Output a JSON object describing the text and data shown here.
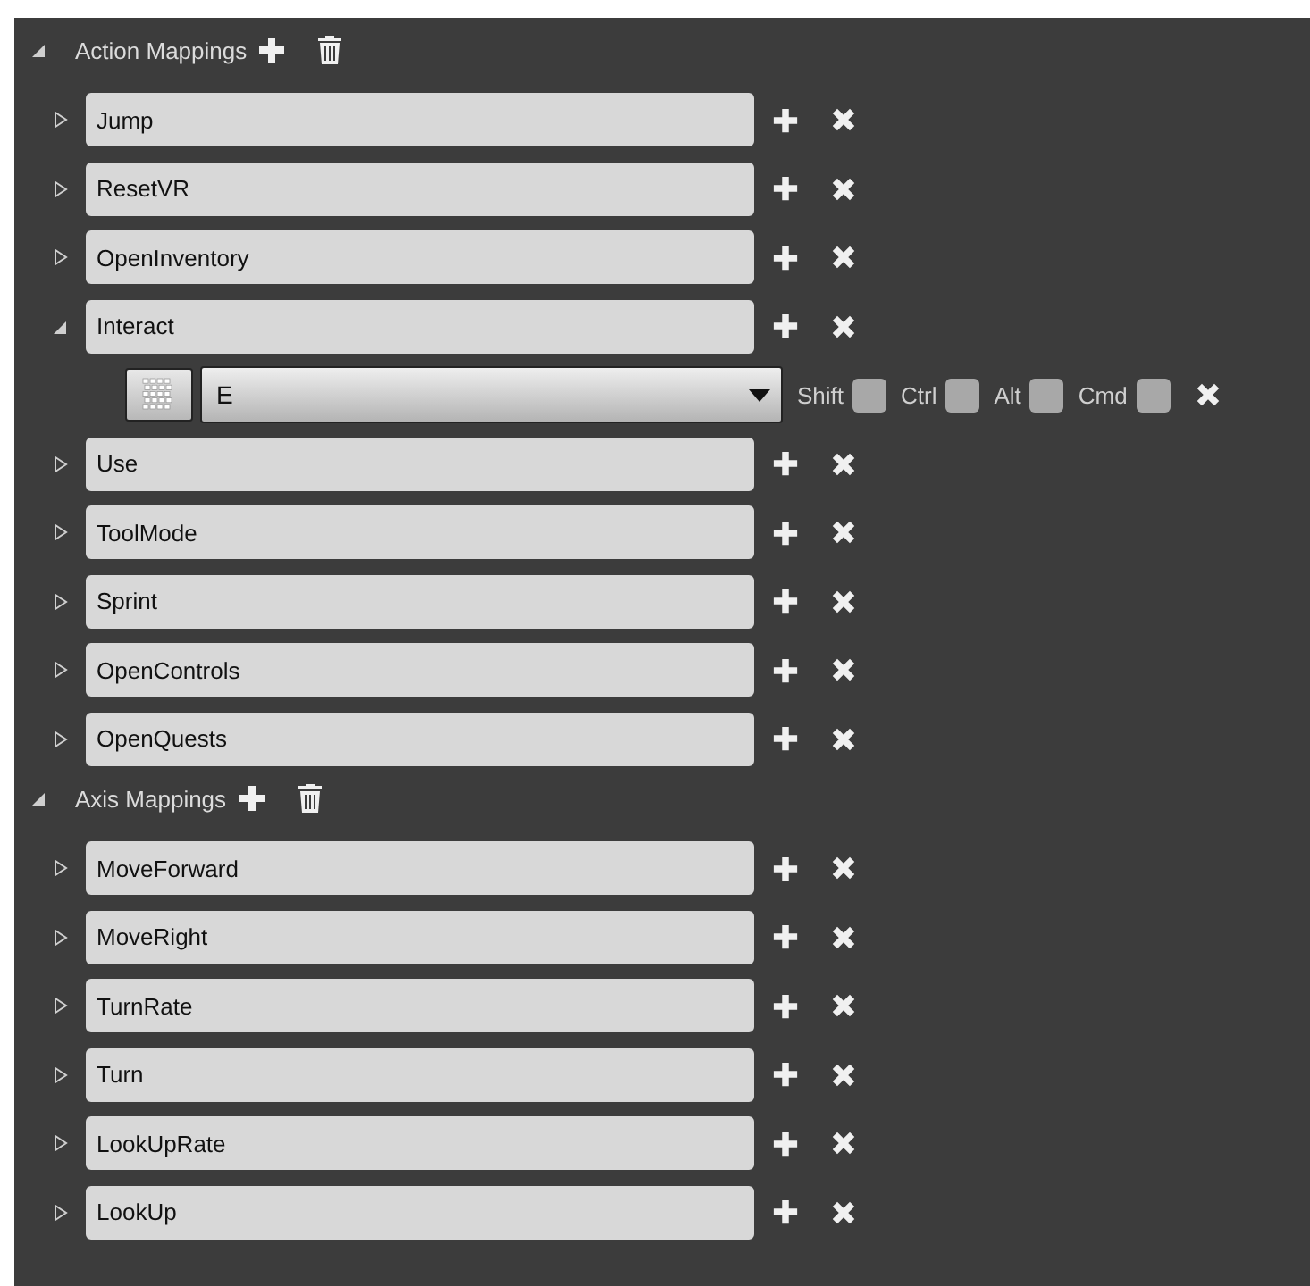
{
  "sections": [
    {
      "title": "Action Mappings",
      "expanded": true,
      "mappings": [
        {
          "name": "Jump",
          "expanded": false
        },
        {
          "name": "ResetVR",
          "expanded": false
        },
        {
          "name": "OpenInventory",
          "expanded": false
        },
        {
          "name": "Interact",
          "expanded": true,
          "keys": [
            {
              "key": "E",
              "modifiers": [
                {
                  "label": "Shift",
                  "checked": false
                },
                {
                  "label": "Ctrl",
                  "checked": false
                },
                {
                  "label": "Alt",
                  "checked": false
                },
                {
                  "label": "Cmd",
                  "checked": false
                }
              ]
            }
          ]
        },
        {
          "name": "Use",
          "expanded": false
        },
        {
          "name": "ToolMode",
          "expanded": false
        },
        {
          "name": "Sprint",
          "expanded": false
        },
        {
          "name": "OpenControls",
          "expanded": false
        },
        {
          "name": "OpenQuests",
          "expanded": false
        }
      ]
    },
    {
      "title": "Axis Mappings",
      "expanded": true,
      "mappings": [
        {
          "name": "MoveForward",
          "expanded": false
        },
        {
          "name": "MoveRight",
          "expanded": false
        },
        {
          "name": "TurnRate",
          "expanded": false
        },
        {
          "name": "Turn",
          "expanded": false
        },
        {
          "name": "LookUpRate",
          "expanded": false
        },
        {
          "name": "LookUp",
          "expanded": false
        }
      ]
    }
  ]
}
